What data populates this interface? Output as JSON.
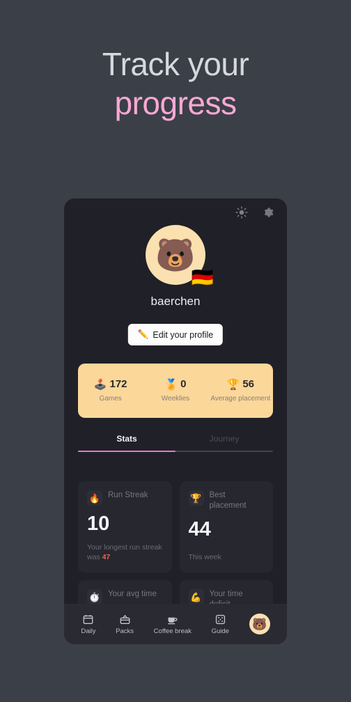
{
  "hero": {
    "line1": "Track your",
    "line2": "progress",
    "line1_color": "#d7d8dc",
    "line2_color": "#f9a8d4"
  },
  "card": {
    "topbar": {
      "brightness_icon": "sun-icon",
      "settings_icon": "gear-icon"
    },
    "profile": {
      "avatar_emoji": "🐻",
      "flag_emoji": "🇩🇪",
      "username": "baerchen",
      "edit_button": {
        "icon": "✏️",
        "label": "Edit your profile"
      }
    },
    "summary": {
      "background": "#fbd79a",
      "items": [
        {
          "icon": "🕹️",
          "value": "172",
          "label": "Games"
        },
        {
          "icon": "🏅",
          "value": "0",
          "label": "Weeklies"
        },
        {
          "icon": "🏆",
          "value": "56",
          "label": "Average placement"
        }
      ]
    },
    "tabs": {
      "items": [
        {
          "label": "Stats",
          "active": true
        },
        {
          "label": "Journey",
          "active": false
        }
      ],
      "indicator_color": "#e879c8"
    },
    "stats": [
      {
        "icon": "🔥",
        "title": "Run Streak",
        "value": "10",
        "sub_prefix": "Your longest run streak was ",
        "sub_highlight": "47",
        "highlight_color": "#e8654c"
      },
      {
        "icon": "🏆",
        "title": "Best placement",
        "value": "44",
        "sub_prefix": "This week",
        "sub_highlight": "",
        "highlight_color": "#e8654c"
      },
      {
        "icon": "⏱️",
        "title": "Your avg time",
        "value": "",
        "sub_prefix": "",
        "sub_highlight": "",
        "highlight_color": "#e8654c"
      },
      {
        "icon": "💪",
        "title": "Your time deficit",
        "value": "",
        "sub_prefix": "",
        "sub_highlight": "",
        "highlight_color": "#e8654c"
      }
    ],
    "nav": {
      "items": [
        {
          "icon": "calendar-icon",
          "label": "Daily"
        },
        {
          "icon": "package-icon",
          "label": "Packs"
        },
        {
          "icon": "coffee-cup-icon",
          "label": "Coffee break"
        },
        {
          "icon": "dice-icon",
          "label": "Guide"
        }
      ],
      "avatar_emoji": "🐻"
    }
  }
}
